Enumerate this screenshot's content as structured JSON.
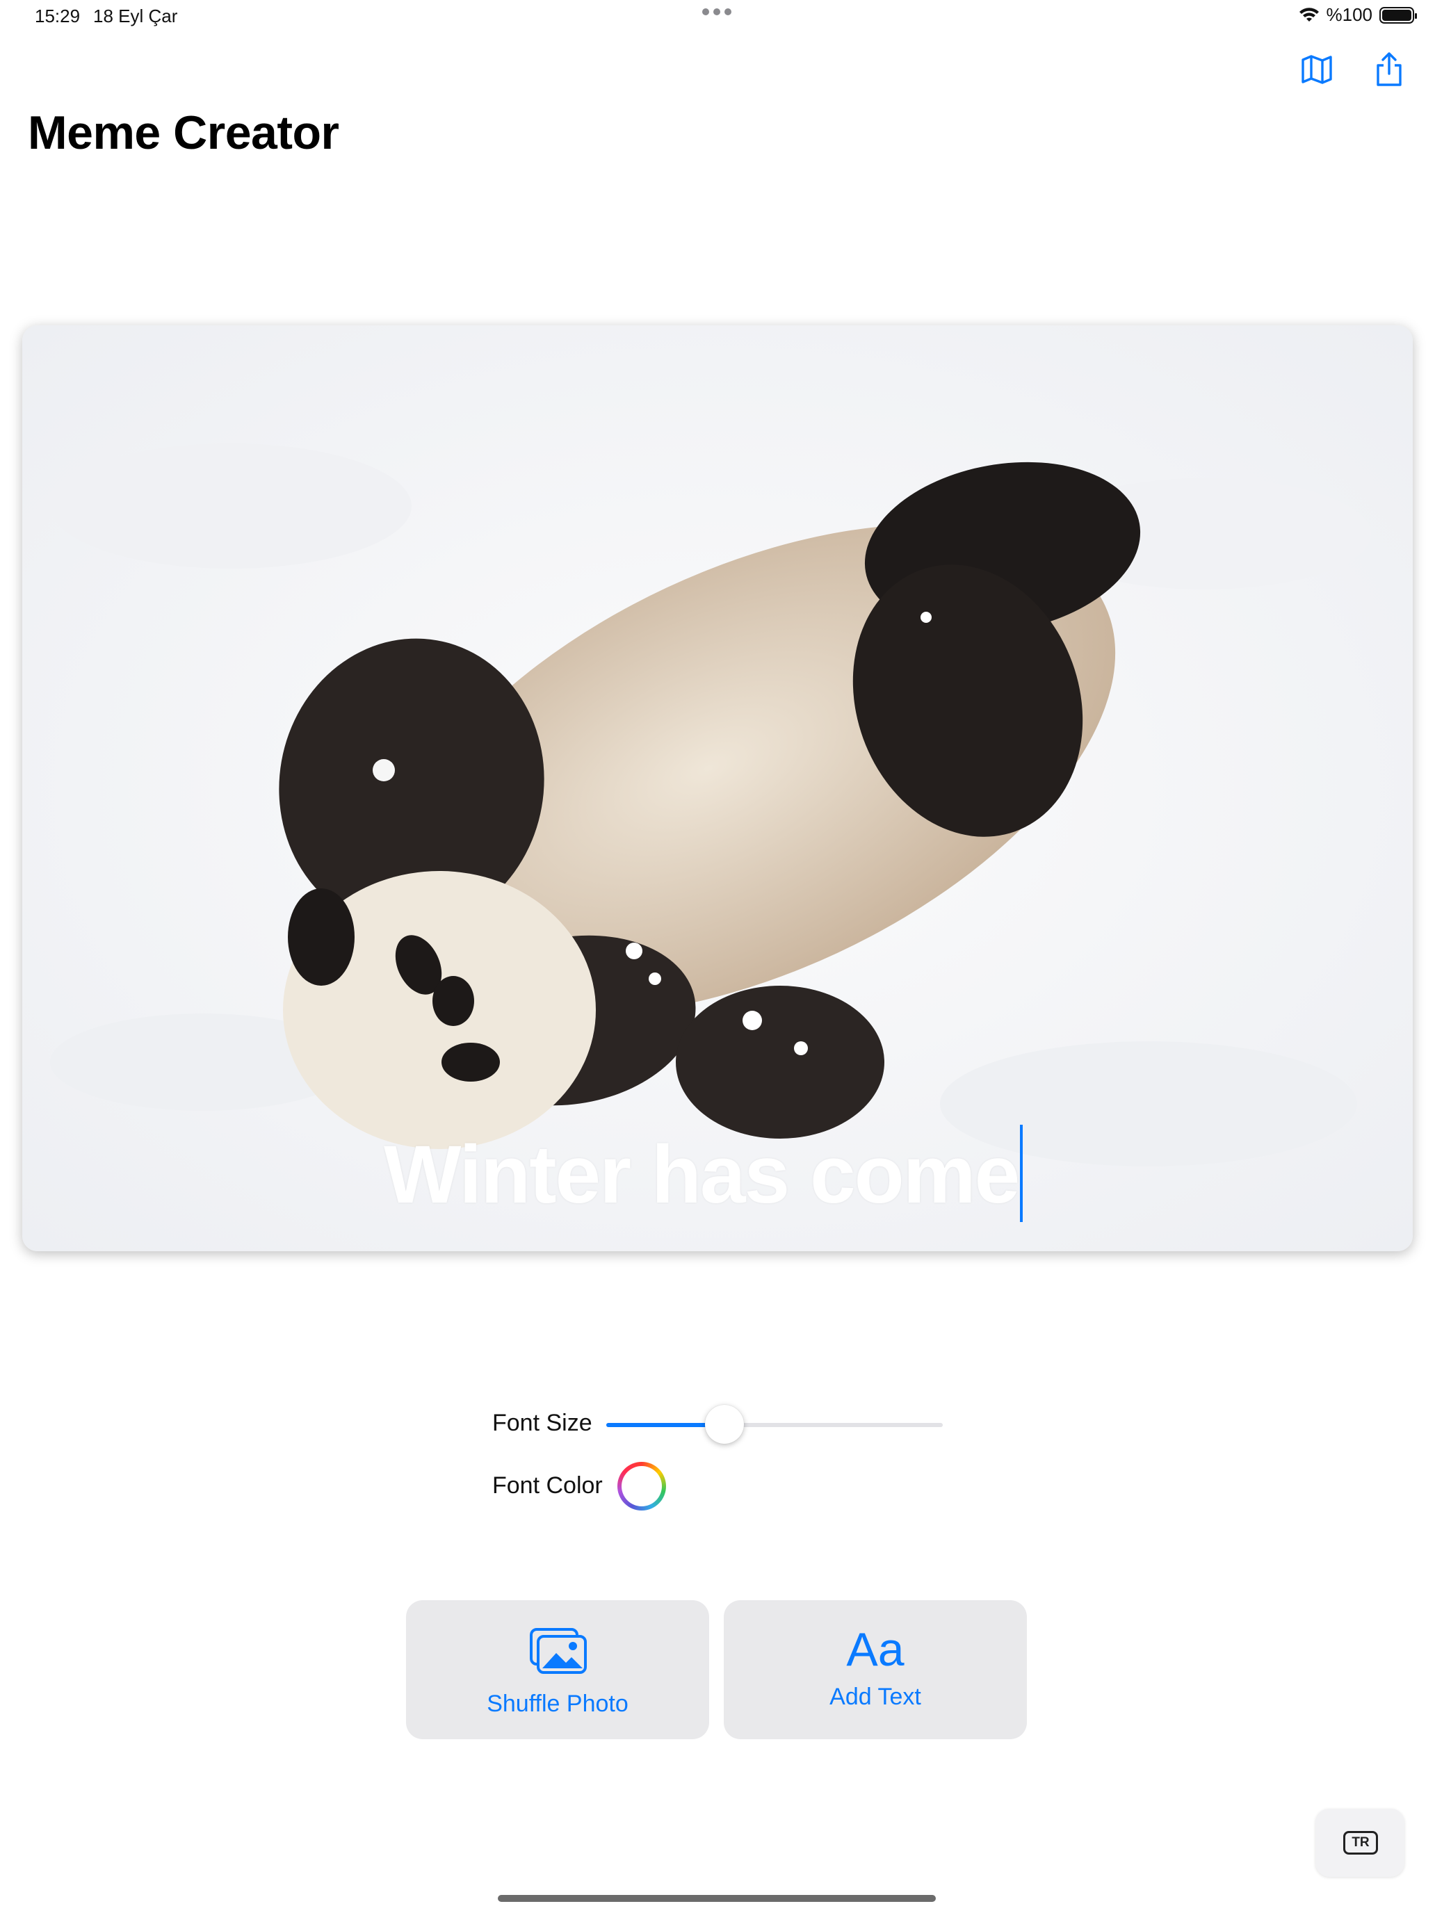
{
  "status_bar": {
    "time": "15:29",
    "date": "18 Eyl Çar",
    "battery": "%100"
  },
  "nav": {
    "title": "Meme Creator",
    "left_icon": "map-icon",
    "right_icon": "share-icon"
  },
  "meme": {
    "text": "Winter has come"
  },
  "controls": {
    "font_size_label": "Font Size",
    "font_size_value": 0.31,
    "font_color_label": "Font Color"
  },
  "buttons": {
    "shuffle_label": "Shuffle Photo",
    "shuffle_icon": "photos-icon",
    "add_text_label": "Add Text",
    "add_text_icon_text": "Aa"
  },
  "keyboard": {
    "language": "TR"
  },
  "colors": {
    "accent": "#0a7aff"
  }
}
